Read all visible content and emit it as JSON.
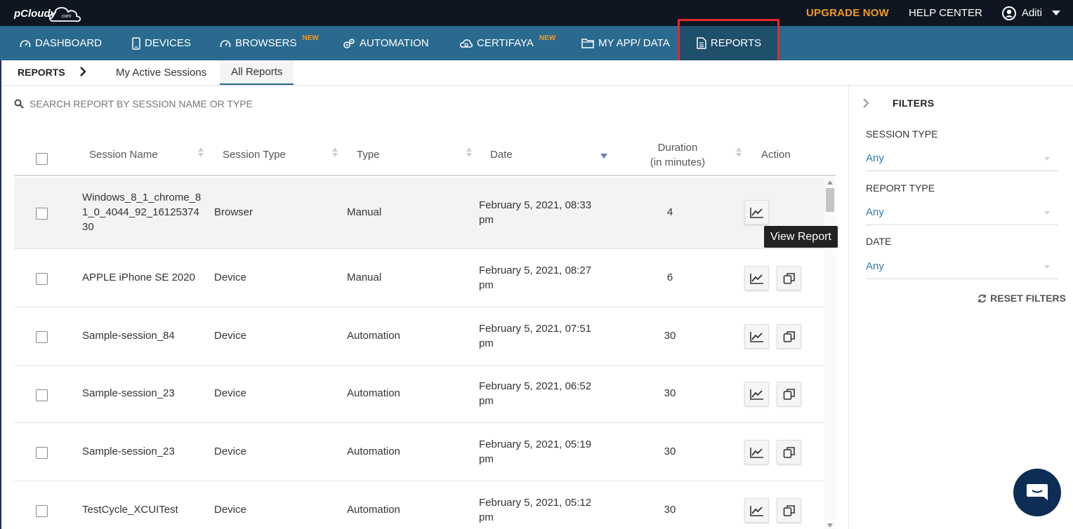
{
  "header": {
    "logo_text": "pCloudy",
    "logo_suffix": ".com",
    "upgrade_label": "UPGRADE NOW",
    "help_label": "HELP CENTER",
    "user_name": "Aditi"
  },
  "nav": {
    "dashboard": "DASHBOARD",
    "devices": "DEVICES",
    "browsers": "BROWSERS",
    "browsers_badge": "NEW",
    "automation": "AUTOMATION",
    "certifaya": "CERTIFAYA",
    "certifaya_badge": "NEW",
    "myapp": "MY APP/ DATA",
    "reports": "REPORTS"
  },
  "subnav": {
    "crumb": "REPORTS",
    "tab_active_sessions": "My Active Sessions",
    "tab_all_reports": "All Reports"
  },
  "search": {
    "placeholder": "SEARCH REPORT BY SESSION NAME OR TYPE"
  },
  "table": {
    "columns": {
      "session_name": "Session Name",
      "session_type": "Session Type",
      "type": "Type",
      "date": "Date",
      "duration_line1": "Duration",
      "duration_line2": "(in minutes)",
      "action": "Action"
    },
    "rows": [
      {
        "name": "Windows_8_1_chrome_81_0_4044_92_1612537430",
        "session_type": "Browser",
        "type": "Manual",
        "date": "February 5, 2021, 08:33 pm",
        "duration": "4"
      },
      {
        "name": "APPLE iPhone SE 2020",
        "session_type": "Device",
        "type": "Manual",
        "date": "February 5, 2021, 08:27 pm",
        "duration": "6"
      },
      {
        "name": "Sample-session_84",
        "session_type": "Device",
        "type": "Automation",
        "date": "February 5, 2021, 07:51 pm",
        "duration": "30"
      },
      {
        "name": "Sample-session_23",
        "session_type": "Device",
        "type": "Automation",
        "date": "February 5, 2021, 06:52 pm",
        "duration": "30"
      },
      {
        "name": "Sample-session_23",
        "session_type": "Device",
        "type": "Automation",
        "date": "February 5, 2021, 05:19 pm",
        "duration": "30"
      },
      {
        "name": "TestCycle_XCUITest",
        "session_type": "Device",
        "type": "Automation",
        "date": "February 5, 2021, 05:12 pm",
        "duration": "30"
      }
    ]
  },
  "tooltip": {
    "text": "View Report"
  },
  "filters": {
    "title": "FILTERS",
    "session_type_label": "SESSION TYPE",
    "session_type_value": "Any",
    "report_type_label": "REPORT TYPE",
    "report_type_value": "Any",
    "date_label": "DATE",
    "date_value": "Any",
    "reset_label": "RESET FILTERS"
  },
  "colors": {
    "topbar": "#0d1621",
    "navbar": "#2a6a8e",
    "nav_active": "#1e4f6b",
    "upgrade": "#f39a22",
    "highlight": "#e5282e",
    "link": "#2b7bb4"
  },
  "icons": {
    "view_report": "line-chart-icon",
    "copy": "copy-icon",
    "search": "search-icon",
    "chat": "chat-icon"
  }
}
